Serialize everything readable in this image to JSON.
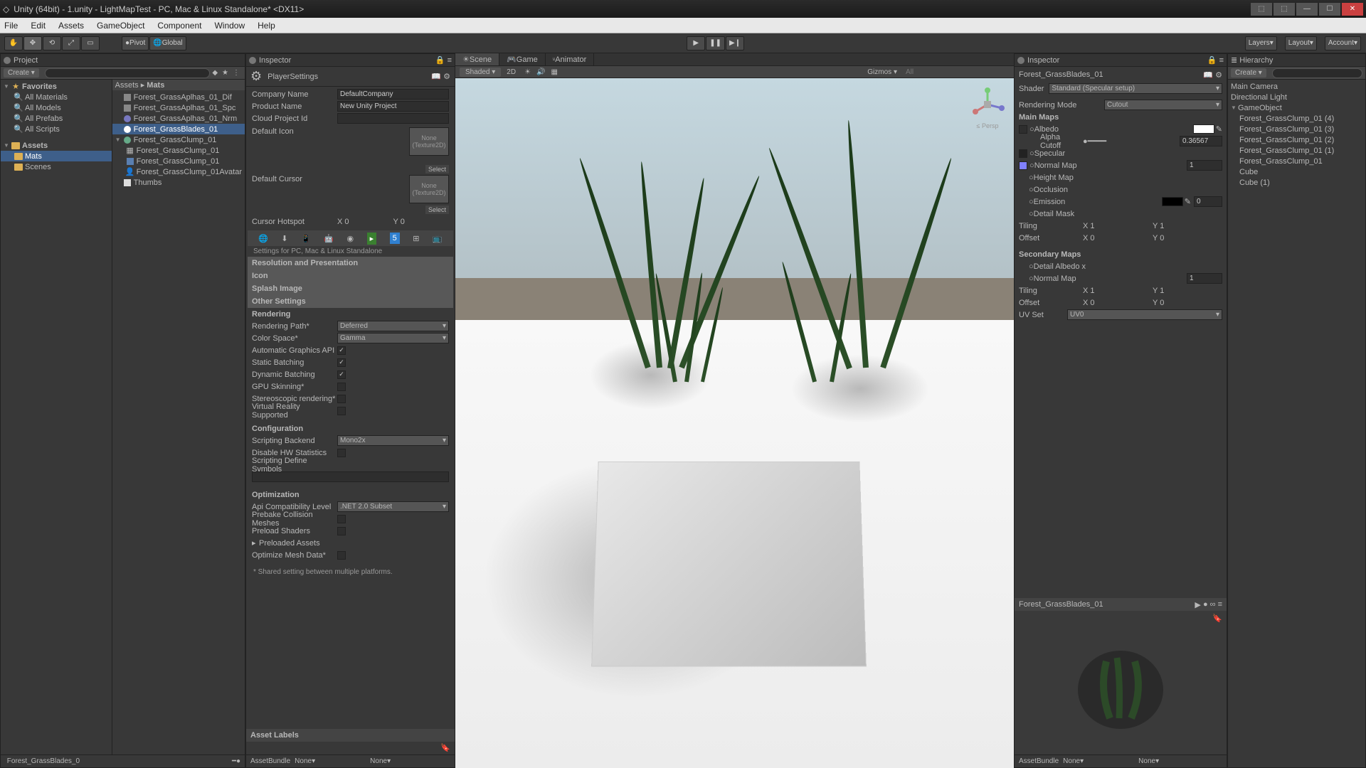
{
  "title": "Unity (64bit) - 1.unity - LightMapTest - PC, Mac & Linux Standalone* <DX11>",
  "menu": [
    "File",
    "Edit",
    "Assets",
    "GameObject",
    "Component",
    "Window",
    "Help"
  ],
  "toolbar": {
    "pivot": "Pivot",
    "global": "Global",
    "layers": "Layers",
    "layout": "Layout",
    "account": "Account"
  },
  "project": {
    "title": "Project",
    "create": "Create",
    "favorites": "Favorites",
    "fav_items": [
      "All Materials",
      "All Models",
      "All Prefabs",
      "All Scripts"
    ],
    "assets": "Assets",
    "mats": "Mats",
    "scenes": "Scenes",
    "breadcrumb_assets": "Assets",
    "breadcrumb_mats": "Mats",
    "files": [
      "Forest_GrassAplhas_01_Dif",
      "Forest_GrassAplhas_01_Spc",
      "Forest_GrassAplhas_01_Nrm",
      "Forest_GrassBlades_01",
      "Forest_GrassClump_01",
      "Forest_GrassClump_01",
      "Forest_GrassClump_01",
      "Forest_GrassClump_01Avatar",
      "Thumbs"
    ],
    "selected_idx": 3,
    "footer": "Forest_GrassBlades_0"
  },
  "inspL": {
    "title": "Inspector",
    "header": "PlayerSettings",
    "company_lbl": "Company Name",
    "company": "DefaultCompany",
    "product_lbl": "Product Name",
    "product": "New Unity Project",
    "cloud_lbl": "Cloud Project Id",
    "cloud": "",
    "defaulticon_lbl": "Default Icon",
    "none_tex": "None\n(Texture2D)",
    "select": "Select",
    "defaultcursor_lbl": "Default Cursor",
    "hotspot_lbl": "Cursor Hotspot",
    "hotspot_x": "X  0",
    "hotspot_y": "Y  0",
    "settings_for": "Settings for PC, Mac & Linux Standalone",
    "sec_rp": "Resolution and Presentation",
    "sec_icon": "Icon",
    "sec_splash": "Splash Image",
    "sec_other": "Other Settings",
    "rendering": "Rendering",
    "rp_lbl": "Rendering Path*",
    "rp": "Deferred",
    "cs_lbl": "Color Space*",
    "cs": "Gamma",
    "agapi_lbl": "Automatic Graphics API",
    "sb_lbl": "Static Batching",
    "db_lbl": "Dynamic Batching",
    "gpu_lbl": "GPU Skinning*",
    "stereo_lbl": "Stereoscopic rendering*",
    "vr_lbl": "Virtual Reality Supported",
    "config": "Configuration",
    "sbk_lbl": "Scripting Backend",
    "sbk": "Mono2x",
    "dhw_lbl": "Disable HW Statistics",
    "sds_lbl": "Scripting Define Symbols",
    "opt": "Optimization",
    "api_lbl": "Api Compatibility Level",
    "api": ".NET 2.0 Subset",
    "pcm_lbl": "Prebake Collision Meshes",
    "pls_lbl": "Preload Shaders",
    "pa_lbl": "Preloaded Assets",
    "omd_lbl": "Optimize Mesh Data*",
    "shared": "*  Shared setting between multiple platforms.",
    "asset_labels": "Asset Labels",
    "assetbundle": "AssetBundle",
    "none": "None"
  },
  "scene": {
    "tab_scene": "Scene",
    "tab_game": "Game",
    "tab_anim": "Animator",
    "shaded": "Shaded",
    "twod": "2D",
    "gizmos": "Gizmos",
    "all": "All",
    "persp": "Persp"
  },
  "inspR": {
    "title": "Inspector",
    "mat_name": "Forest_GrassBlades_01",
    "shader_lbl": "Shader",
    "shader": "Standard (Specular setup)",
    "rm_lbl": "Rendering Mode",
    "rm": "Cutout",
    "main_maps": "Main Maps",
    "albedo": "Albedo",
    "alpha_lbl": "Alpha Cutoff",
    "alpha": "0.36567",
    "specular": "Specular",
    "normal": "Normal Map",
    "normal_v": "1",
    "height": "Height Map",
    "occ": "Occlusion",
    "emission": "Emission",
    "emission_v": "0",
    "detailmask": "Detail Mask",
    "tiling": "Tiling",
    "offset": "Offset",
    "x1": "X  1",
    "y1": "Y  1",
    "x0": "X  0",
    "y0": "Y  0",
    "sec_maps": "Secondary Maps",
    "det_albedo": "Detail Albedo x",
    "uvset_lbl": "UV Set",
    "uvset": "UV0",
    "preview_title": "Forest_GrassBlades_01",
    "assetbundle": "AssetBundle",
    "none": "None"
  },
  "hier": {
    "title": "Hierarchy",
    "create": "Create",
    "items": [
      "Main Camera",
      "Directional Light",
      "GameObject",
      "Forest_GrassClump_01 (4)",
      "Forest_GrassClump_01 (3)",
      "Forest_GrassClump_01 (2)",
      "Forest_GrassClump_01 (1)",
      "Forest_GrassClump_01",
      "Cube",
      "Cube (1)"
    ]
  }
}
